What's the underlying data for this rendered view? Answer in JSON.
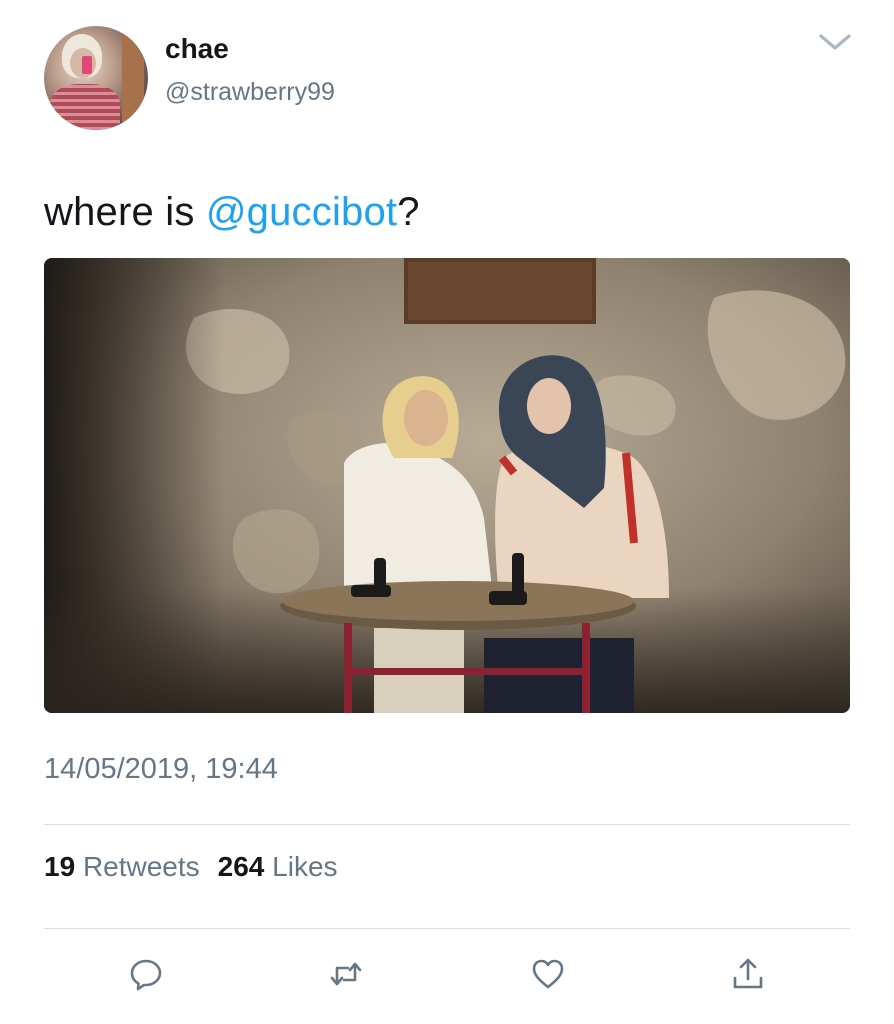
{
  "user": {
    "display_name": "chae",
    "handle": "@strawberry99"
  },
  "tweet": {
    "text_before": "where is ",
    "mention": "@guccibot",
    "text_after": "?",
    "timestamp": "14/05/2019, 19:44"
  },
  "stats": {
    "retweets_count": "19",
    "retweets_label": "Retweets",
    "likes_count": "264",
    "likes_label": "Likes"
  },
  "icons": {
    "menu": "chevron-down-icon",
    "reply": "reply-icon",
    "retweet": "retweet-icon",
    "like": "heart-icon",
    "share": "share-icon"
  },
  "colors": {
    "text": "#14171a",
    "secondary": "#657786",
    "link": "#1da1f2",
    "divider": "#d8dde2"
  }
}
